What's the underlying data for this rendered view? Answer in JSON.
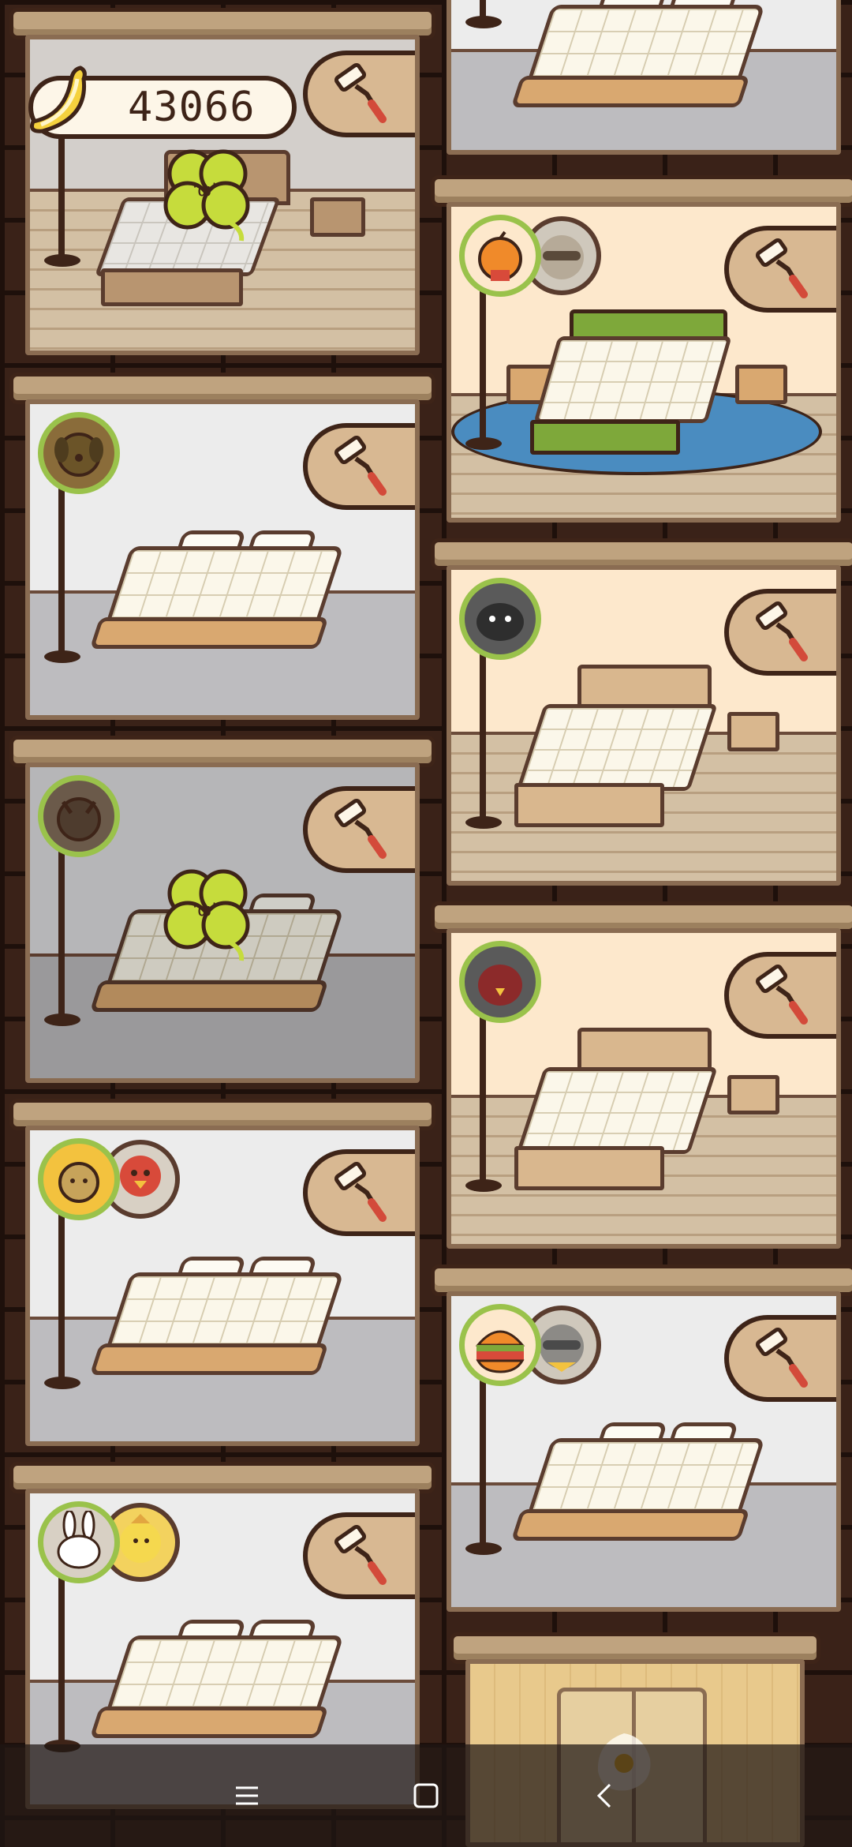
{
  "hud": {
    "banana_icon": "banana-icon",
    "banana_count": "43066"
  },
  "rooms": [
    {
      "id": "left-1",
      "theme": "bedroom-wood",
      "guests": [
        "clover"
      ]
    },
    {
      "id": "left-2",
      "theme": "bedroom-gray",
      "guests": [
        "dog"
      ]
    },
    {
      "id": "left-3",
      "theme": "bedroom-dark",
      "guests": [
        "bat",
        "clover"
      ]
    },
    {
      "id": "left-4",
      "theme": "bedroom-gray",
      "guests": [
        "lion",
        "parrot"
      ]
    },
    {
      "id": "left-5",
      "theme": "bedroom-gray",
      "guests": [
        "bunny",
        "chick"
      ]
    },
    {
      "id": "right-0",
      "theme": "bedroom-gray",
      "guests": []
    },
    {
      "id": "right-1",
      "theme": "bedroom-green",
      "guests": [
        "orange",
        "raccoon"
      ]
    },
    {
      "id": "right-2",
      "theme": "bedroom-wood",
      "guests": [
        "dark-blob"
      ]
    },
    {
      "id": "right-3",
      "theme": "bedroom-wood",
      "guests": [
        "red-bird"
      ]
    },
    {
      "id": "right-4",
      "theme": "bedroom-gray",
      "guests": [
        "burger",
        "raccoon"
      ]
    },
    {
      "id": "right-5",
      "theme": "lobby-door",
      "guests": []
    }
  ],
  "colors": {
    "brick": "#3a2218",
    "frame": "#8a6c52",
    "avatar_ring": "#9ac24b",
    "button_bg": "#d8b892",
    "clover": "#c6dc3c"
  },
  "icons": {
    "clean": "roller-icon",
    "nav_menu": "menu-icon",
    "nav_home": "home-icon",
    "nav_back": "back-icon"
  }
}
